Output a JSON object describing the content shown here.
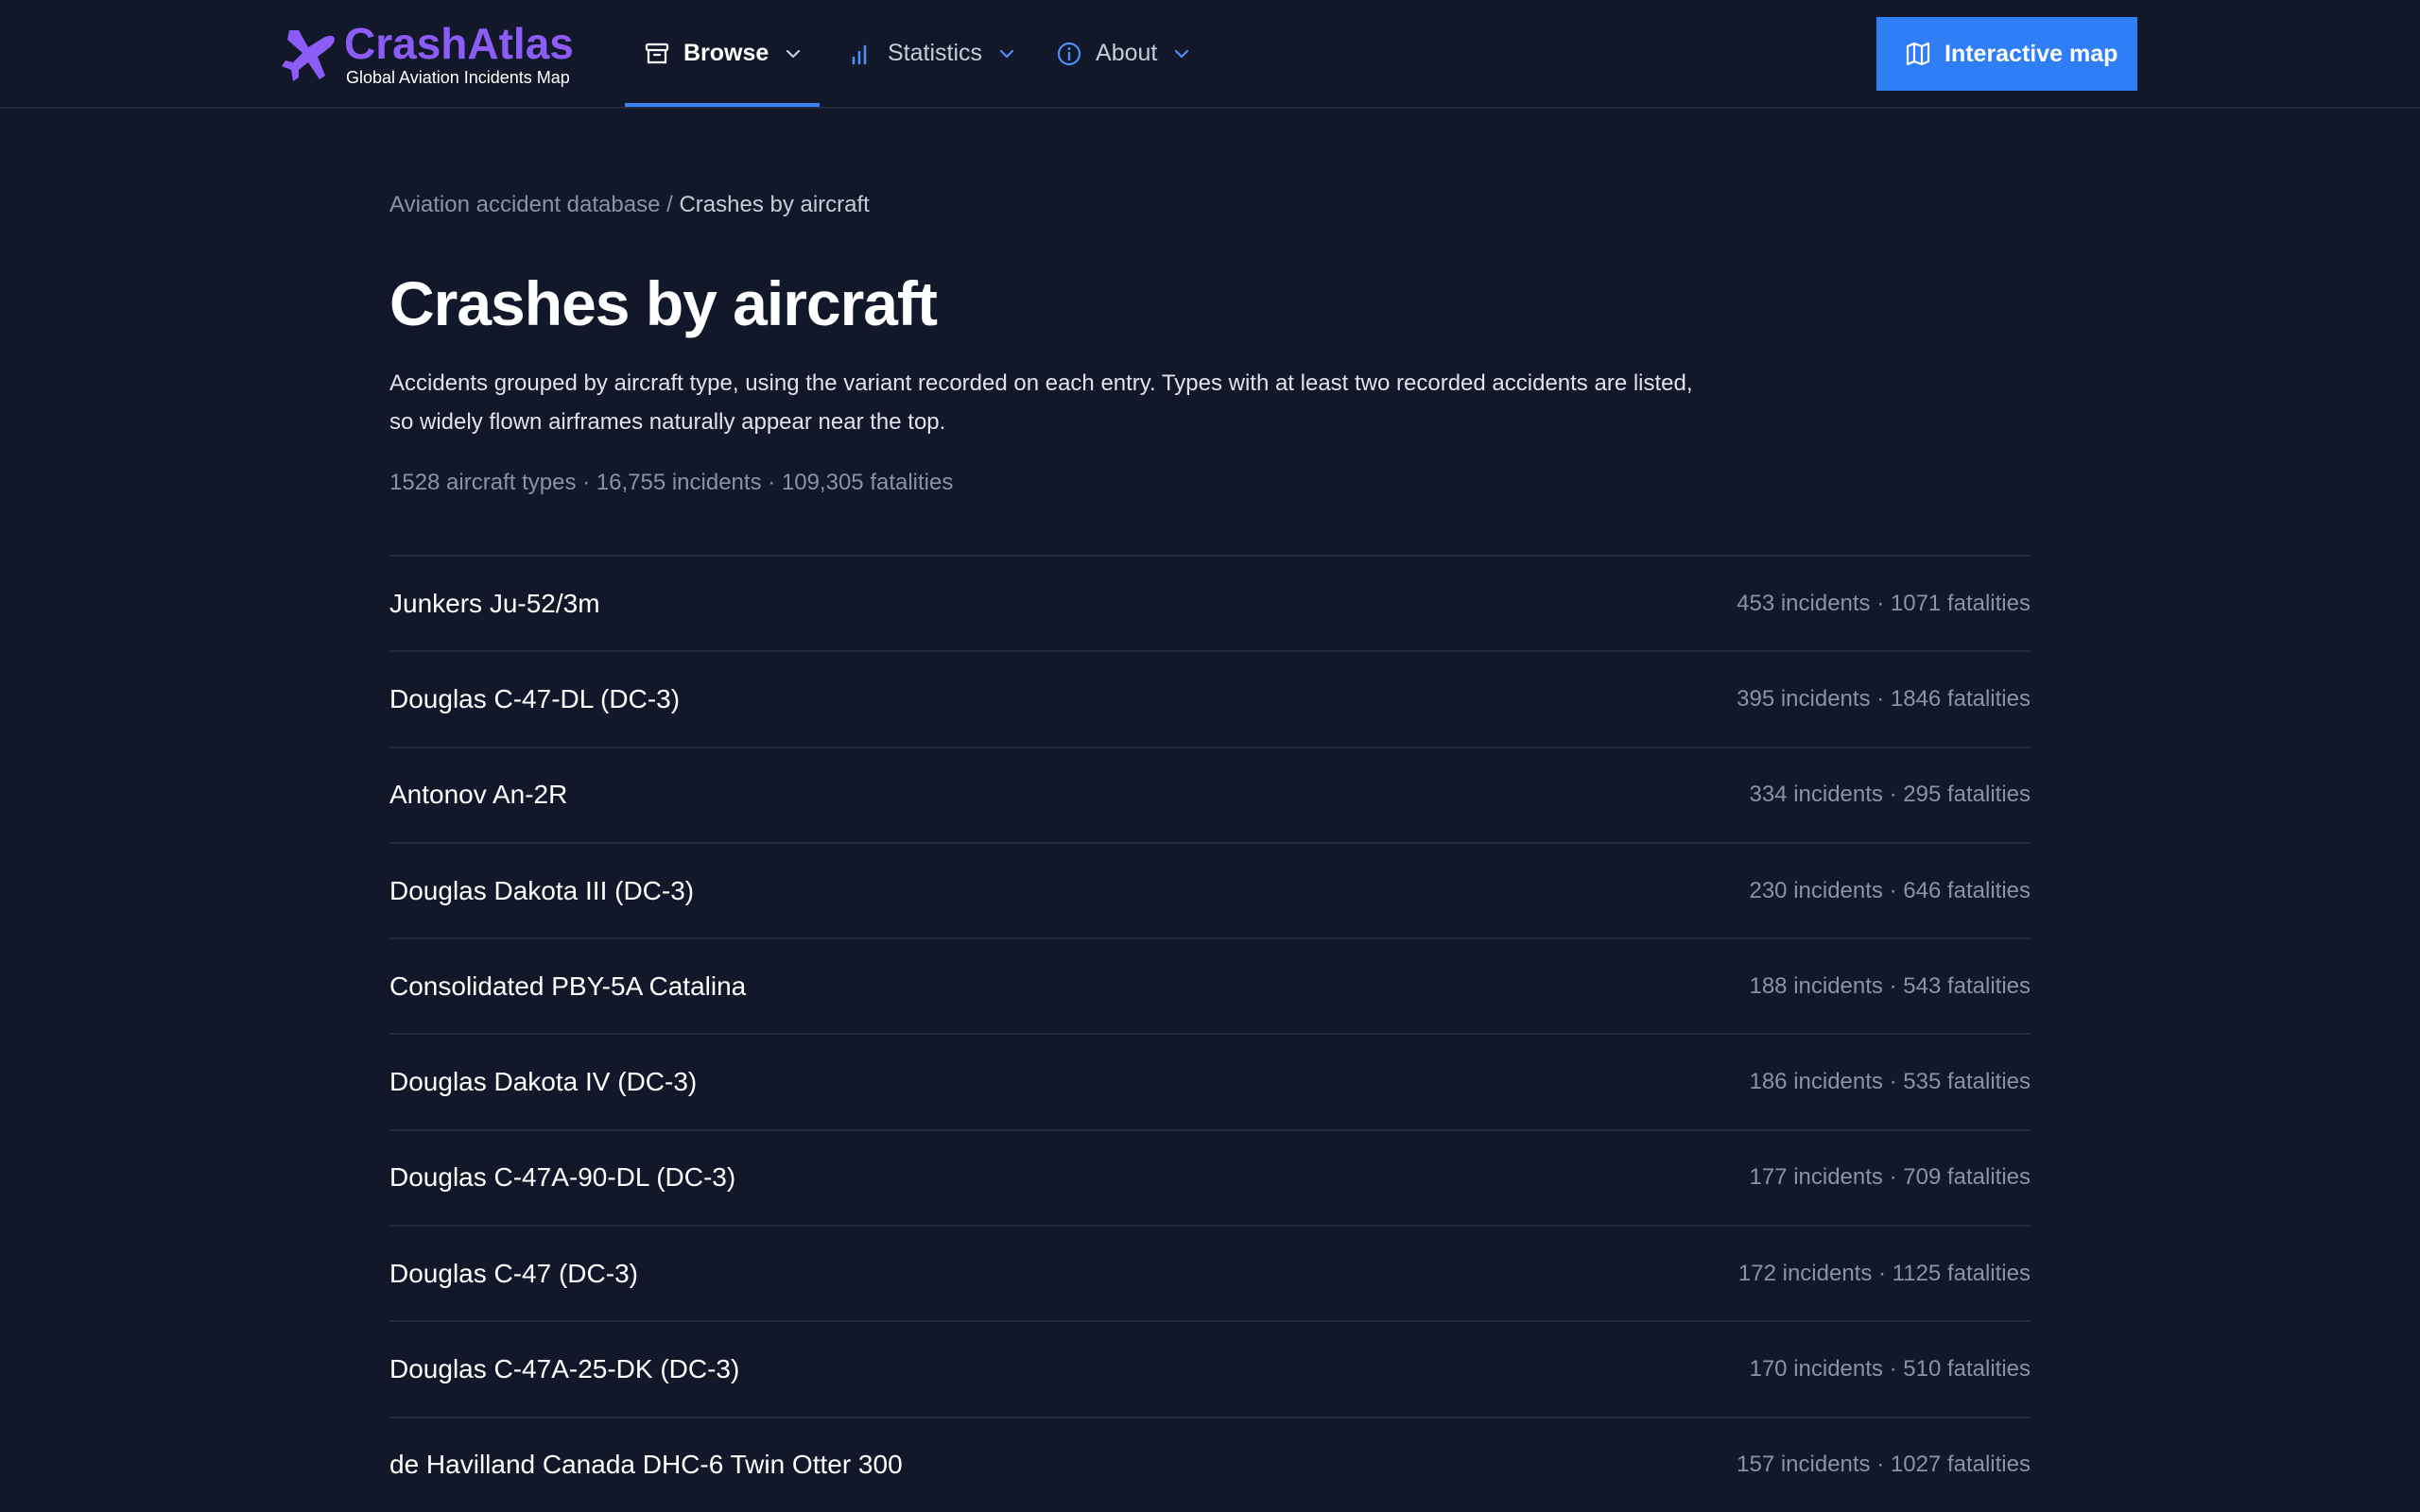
{
  "header": {
    "brand_name": "CrashAtlas",
    "brand_tagline": "Global Aviation Incidents Map",
    "nav": [
      {
        "label": "Browse",
        "icon": "archive-icon",
        "active": true
      },
      {
        "label": "Statistics",
        "icon": "bar-chart-icon",
        "active": false
      },
      {
        "label": "About",
        "icon": "info-icon",
        "active": false
      }
    ],
    "map_button_label": "Interactive map"
  },
  "breadcrumb": {
    "parent": "Aviation accident database",
    "separator": " / ",
    "current": "Crashes by aircraft"
  },
  "page": {
    "title": "Crashes by aircraft",
    "intro": "Accidents grouped by aircraft type, using the variant recorded on each entry. Types with at least two recorded accidents are listed, so widely flown airframes naturally appear near the top.",
    "summary": "1528 aircraft types · 16,755 incidents · 109,305 fatalities"
  },
  "aircraft": [
    {
      "name": "Junkers Ju-52/3m",
      "stats": "453 incidents · 1071 fatalities"
    },
    {
      "name": "Douglas C-47-DL (DC-3)",
      "stats": "395 incidents · 1846 fatalities"
    },
    {
      "name": "Antonov An-2R",
      "stats": "334 incidents · 295 fatalities"
    },
    {
      "name": "Douglas Dakota III (DC-3)",
      "stats": "230 incidents · 646 fatalities"
    },
    {
      "name": "Consolidated PBY-5A Catalina",
      "stats": "188 incidents · 543 fatalities"
    },
    {
      "name": "Douglas Dakota IV (DC-3)",
      "stats": "186 incidents · 535 fatalities"
    },
    {
      "name": "Douglas C-47A-90-DL (DC-3)",
      "stats": "177 incidents · 709 fatalities"
    },
    {
      "name": "Douglas C-47 (DC-3)",
      "stats": "172 incidents · 1125 fatalities"
    },
    {
      "name": "Douglas C-47A-25-DK (DC-3)",
      "stats": "170 incidents · 510 fatalities"
    },
    {
      "name": "de Havilland Canada DHC-6 Twin Otter 300",
      "stats": "157 incidents · 1027 fatalities"
    }
  ],
  "colors": {
    "background": "#121829",
    "brand": "#8b5cf6",
    "accent": "#2f7ef6",
    "muted_text": "#8a93a5",
    "divider": "#232b3d"
  }
}
